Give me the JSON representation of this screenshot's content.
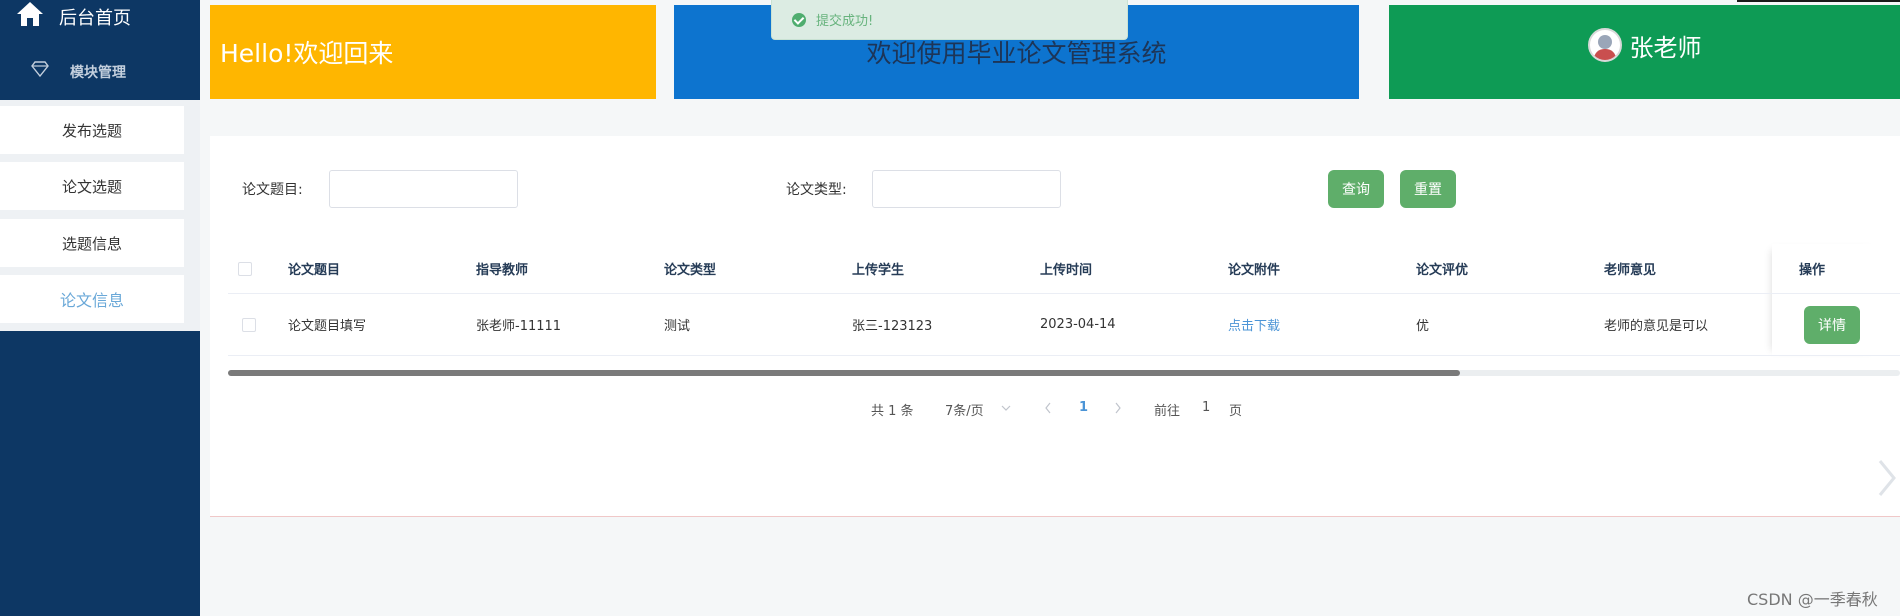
{
  "sidebar": {
    "home_label": "后台首页",
    "module_label": "模块管理",
    "items": [
      {
        "label": "发布选题"
      },
      {
        "label": "论文选题"
      },
      {
        "label": "选题信息"
      },
      {
        "label": "论文信息",
        "active": true
      }
    ]
  },
  "cards": {
    "greeting": "Hello!欢迎回来",
    "welcome": "欢迎使用毕业论文管理系统",
    "teacher_name": "张老师"
  },
  "toast": {
    "message": "提交成功!"
  },
  "search": {
    "title_label": "论文题目:",
    "title_value": "",
    "type_label": "论文类型:",
    "type_value": "",
    "query_button": "查询",
    "reset_button": "重置"
  },
  "table": {
    "columns": [
      "论文题目",
      "指导教师",
      "论文类型",
      "上传学生",
      "上传时间",
      "论文附件",
      "论文评优",
      "老师意见",
      "操作"
    ],
    "rows": [
      {
        "title": "论文题目填写",
        "teacher": "张老师-11111",
        "type": "测试",
        "student": "张三-123123",
        "time": "2023-04-14",
        "attachment": "点击下载",
        "rating": "优",
        "comment": "老师的意见是可以",
        "action": "详情"
      }
    ]
  },
  "pagination": {
    "total": "共 1 条",
    "page_size": "7条/页",
    "current_page": "1",
    "goto_prefix": "前往",
    "goto_value": "1",
    "goto_suffix": "页"
  },
  "watermark": "CSDN @一季春秋",
  "colors": {
    "sidebar_bg": "#0d3764",
    "card_yellow": "#ffb600",
    "card_blue": "#0d74cf",
    "card_green": "#0e9b55",
    "button_green": "#5fae6a",
    "link_blue": "#4b94d6"
  }
}
